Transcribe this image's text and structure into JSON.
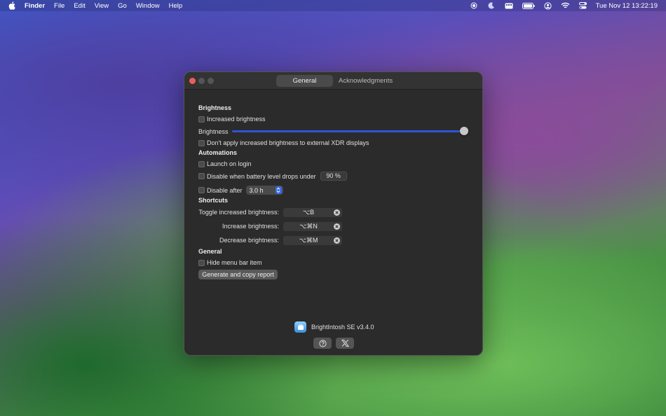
{
  "menubar": {
    "items": [
      "Finder",
      "File",
      "Edit",
      "View",
      "Go",
      "Window",
      "Help"
    ],
    "clock": "Tue Nov 12  13:22:19",
    "status_icons": [
      "screen-record-icon",
      "moon-icon",
      "display-icon",
      "battery-icon",
      "user-icon",
      "wifi-icon",
      "control-center-icon"
    ]
  },
  "window": {
    "tabs": [
      "General",
      "Acknowledgments"
    ],
    "active_tab": "General",
    "brightness_section": {
      "title": "Brightness",
      "increased_label": "Increased brightness",
      "slider_label": "Brightness",
      "slider_value_fraction": 1.0,
      "xdr_label": "Don't apply increased brightness to external XDR displays"
    },
    "automations_section": {
      "title": "Automations",
      "launch_label": "Launch on login",
      "battery_label": "Disable when battery level drops under",
      "battery_value": "90 %",
      "disable_after_label": "Disable after",
      "disable_after_value": "3.0 h"
    },
    "shortcuts_section": {
      "title": "Shortcuts",
      "items": [
        {
          "label": "Toggle increased brightness:",
          "keys": "⌥B"
        },
        {
          "label": "Increase brightness:",
          "keys": "⌥⌘N"
        },
        {
          "label": "Decrease brightness:",
          "keys": "⌥⌘M"
        }
      ]
    },
    "general_section": {
      "title": "General",
      "hide_label": "Hide menu bar item",
      "report_button": "Generate and copy report"
    },
    "footer": {
      "app_name": "BrightIntosh SE v3.4.0",
      "help_icon": "help-circle-icon",
      "x_icon": "x-logo-icon"
    },
    "accent_color": "#2f55d4"
  }
}
